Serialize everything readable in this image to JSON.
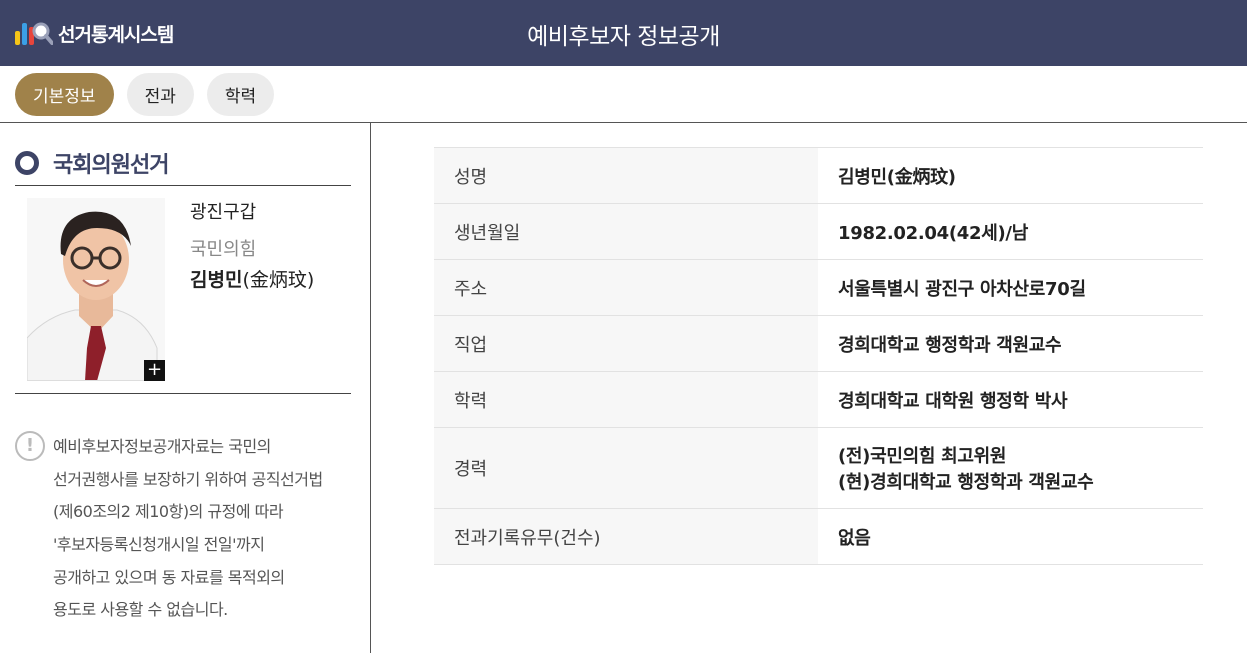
{
  "app": {
    "logo_text": "선거통계시스템",
    "page_title": "예비후보자 정보공개"
  },
  "tabs": [
    {
      "label": "기본정보",
      "active": true
    },
    {
      "label": "전과",
      "active": false
    },
    {
      "label": "학력",
      "active": false
    }
  ],
  "election": {
    "title": "국회의원선거"
  },
  "candidate": {
    "district": "광진구갑",
    "party": "국민의힘",
    "name": "김병민",
    "hanja": "(金炳玟)",
    "zoom_label": "+"
  },
  "notice": {
    "icon_label": "!",
    "lines": [
      "예비후보자정보공개자료는 국민의",
      "선거권행사를 보장하기 위하여 공직선거법",
      "(제60조의2 제10항)의 규정에 따라",
      "'후보자등록신청개시일 전일'까지",
      "공개하고 있으며 동 자료를 목적외의",
      "용도로 사용할 수 없습니다."
    ]
  },
  "info_rows": [
    {
      "label": "성명",
      "value": "김병민(金炳玟)"
    },
    {
      "label": "생년월일",
      "value": "1982.02.04(42세)/남"
    },
    {
      "label": "주소",
      "value": "서울특별시 광진구 아차산로70길"
    },
    {
      "label": "직업",
      "value": "경희대학교 행정학과 객원교수"
    },
    {
      "label": "학력",
      "value": "경희대학교 대학원 행정학 박사"
    },
    {
      "label": "경력",
      "value_lines": [
        "(전)국민의힘 최고위원",
        "(현)경희대학교 행정학과 객원교수"
      ]
    },
    {
      "label": "전과기록유무(건수)",
      "value": "없음"
    }
  ],
  "colors": {
    "header_bg": "#3d4466",
    "tab_active": "#a0824a",
    "tab_inactive": "#ececec"
  }
}
